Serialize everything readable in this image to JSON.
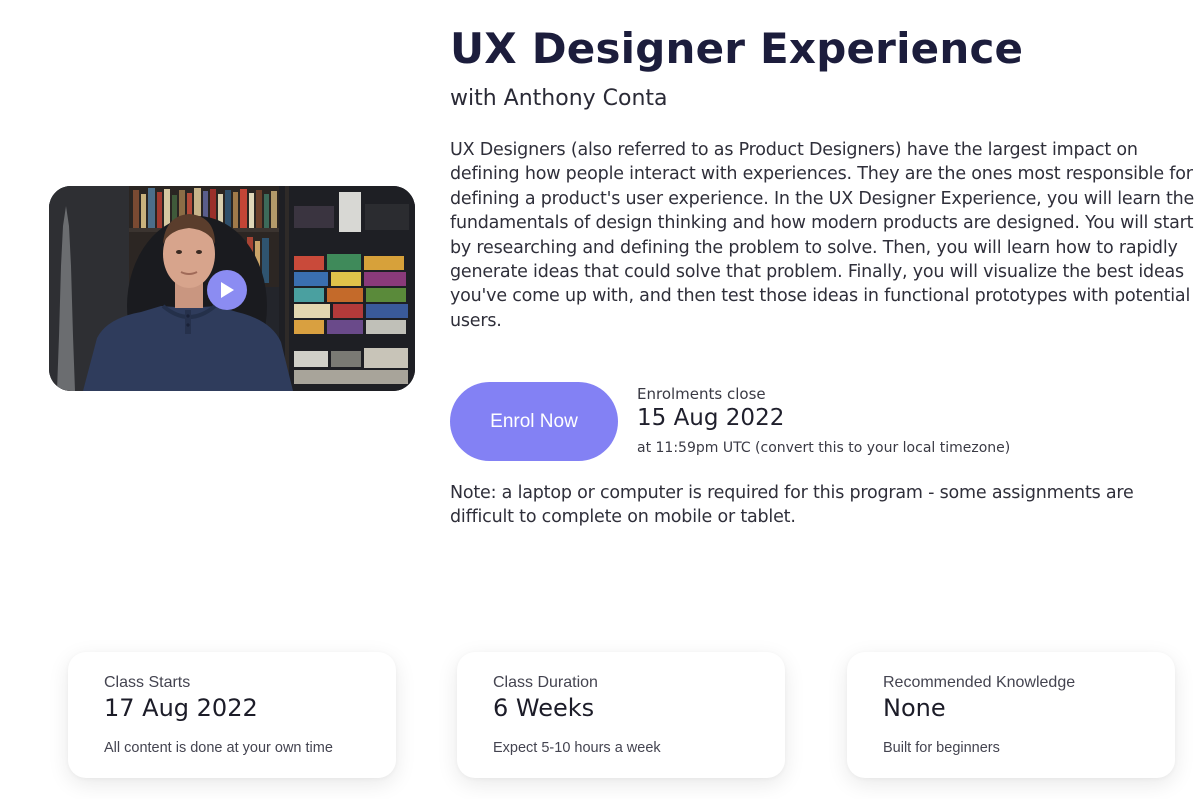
{
  "course": {
    "title": "UX Designer Experience",
    "instructor": "with Anthony Conta",
    "description": "UX Designers (also referred to as Product Designers) have the largest impact on defining how people interact with experiences. They are the ones most responsible for defining a product's user experience. In the UX Designer Experience, you will learn the fundamentals of design thinking and how modern products are designed. You will start by researching and defining the problem to solve. Then, you will learn how to rapidly generate ideas that could solve that problem. Finally, you will visualize the best ideas you've come up with, and then test those ideas in functional prototypes with potential users."
  },
  "video": {
    "play_icon": "play-icon",
    "accent": "#8b8cf2"
  },
  "enrolment": {
    "button_label": "Enrol Now",
    "button_color": "#8381f4",
    "close_label": "Enrolments close",
    "close_date": "15 Aug 2022",
    "close_time_prefix": "at 11:59pm UTC ",
    "close_time_link": "(convert this to your local timezone)"
  },
  "note": "Note: a laptop or computer is required for this program - some assignments are difficult to complete on mobile or tablet.",
  "cards": [
    {
      "label": "Class Starts",
      "value": "17 Aug 2022",
      "note": "All content is done at your own time"
    },
    {
      "label": "Class Duration",
      "value": "6 Weeks",
      "note": "Expect 5-10 hours a week"
    },
    {
      "label": "Recommended Knowledge",
      "value": "None",
      "note": "Built for beginners"
    }
  ]
}
